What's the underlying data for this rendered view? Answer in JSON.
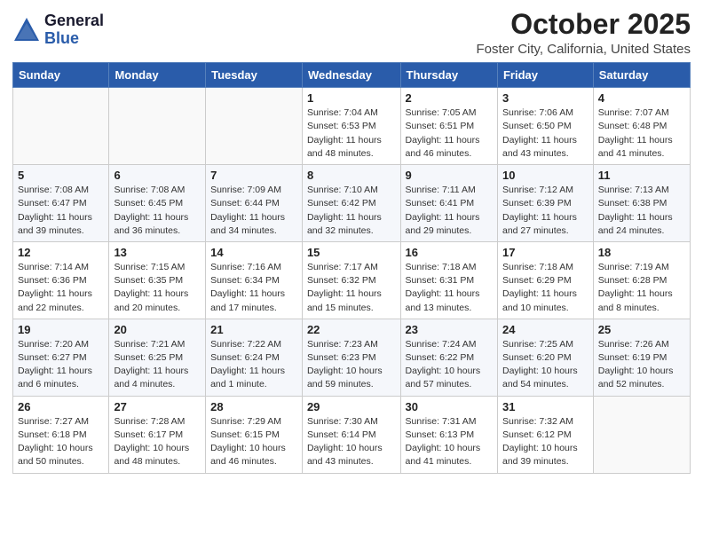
{
  "logo": {
    "general": "General",
    "blue": "Blue"
  },
  "header": {
    "month": "October 2025",
    "location": "Foster City, California, United States"
  },
  "days_of_week": [
    "Sunday",
    "Monday",
    "Tuesday",
    "Wednesday",
    "Thursday",
    "Friday",
    "Saturday"
  ],
  "weeks": [
    [
      {
        "day": "",
        "info": ""
      },
      {
        "day": "",
        "info": ""
      },
      {
        "day": "",
        "info": ""
      },
      {
        "day": "1",
        "info": "Sunrise: 7:04 AM\nSunset: 6:53 PM\nDaylight: 11 hours\nand 48 minutes."
      },
      {
        "day": "2",
        "info": "Sunrise: 7:05 AM\nSunset: 6:51 PM\nDaylight: 11 hours\nand 46 minutes."
      },
      {
        "day": "3",
        "info": "Sunrise: 7:06 AM\nSunset: 6:50 PM\nDaylight: 11 hours\nand 43 minutes."
      },
      {
        "day": "4",
        "info": "Sunrise: 7:07 AM\nSunset: 6:48 PM\nDaylight: 11 hours\nand 41 minutes."
      }
    ],
    [
      {
        "day": "5",
        "info": "Sunrise: 7:08 AM\nSunset: 6:47 PM\nDaylight: 11 hours\nand 39 minutes."
      },
      {
        "day": "6",
        "info": "Sunrise: 7:08 AM\nSunset: 6:45 PM\nDaylight: 11 hours\nand 36 minutes."
      },
      {
        "day": "7",
        "info": "Sunrise: 7:09 AM\nSunset: 6:44 PM\nDaylight: 11 hours\nand 34 minutes."
      },
      {
        "day": "8",
        "info": "Sunrise: 7:10 AM\nSunset: 6:42 PM\nDaylight: 11 hours\nand 32 minutes."
      },
      {
        "day": "9",
        "info": "Sunrise: 7:11 AM\nSunset: 6:41 PM\nDaylight: 11 hours\nand 29 minutes."
      },
      {
        "day": "10",
        "info": "Sunrise: 7:12 AM\nSunset: 6:39 PM\nDaylight: 11 hours\nand 27 minutes."
      },
      {
        "day": "11",
        "info": "Sunrise: 7:13 AM\nSunset: 6:38 PM\nDaylight: 11 hours\nand 24 minutes."
      }
    ],
    [
      {
        "day": "12",
        "info": "Sunrise: 7:14 AM\nSunset: 6:36 PM\nDaylight: 11 hours\nand 22 minutes."
      },
      {
        "day": "13",
        "info": "Sunrise: 7:15 AM\nSunset: 6:35 PM\nDaylight: 11 hours\nand 20 minutes."
      },
      {
        "day": "14",
        "info": "Sunrise: 7:16 AM\nSunset: 6:34 PM\nDaylight: 11 hours\nand 17 minutes."
      },
      {
        "day": "15",
        "info": "Sunrise: 7:17 AM\nSunset: 6:32 PM\nDaylight: 11 hours\nand 15 minutes."
      },
      {
        "day": "16",
        "info": "Sunrise: 7:18 AM\nSunset: 6:31 PM\nDaylight: 11 hours\nand 13 minutes."
      },
      {
        "day": "17",
        "info": "Sunrise: 7:18 AM\nSunset: 6:29 PM\nDaylight: 11 hours\nand 10 minutes."
      },
      {
        "day": "18",
        "info": "Sunrise: 7:19 AM\nSunset: 6:28 PM\nDaylight: 11 hours\nand 8 minutes."
      }
    ],
    [
      {
        "day": "19",
        "info": "Sunrise: 7:20 AM\nSunset: 6:27 PM\nDaylight: 11 hours\nand 6 minutes."
      },
      {
        "day": "20",
        "info": "Sunrise: 7:21 AM\nSunset: 6:25 PM\nDaylight: 11 hours\nand 4 minutes."
      },
      {
        "day": "21",
        "info": "Sunrise: 7:22 AM\nSunset: 6:24 PM\nDaylight: 11 hours\nand 1 minute."
      },
      {
        "day": "22",
        "info": "Sunrise: 7:23 AM\nSunset: 6:23 PM\nDaylight: 10 hours\nand 59 minutes."
      },
      {
        "day": "23",
        "info": "Sunrise: 7:24 AM\nSunset: 6:22 PM\nDaylight: 10 hours\nand 57 minutes."
      },
      {
        "day": "24",
        "info": "Sunrise: 7:25 AM\nSunset: 6:20 PM\nDaylight: 10 hours\nand 54 minutes."
      },
      {
        "day": "25",
        "info": "Sunrise: 7:26 AM\nSunset: 6:19 PM\nDaylight: 10 hours\nand 52 minutes."
      }
    ],
    [
      {
        "day": "26",
        "info": "Sunrise: 7:27 AM\nSunset: 6:18 PM\nDaylight: 10 hours\nand 50 minutes."
      },
      {
        "day": "27",
        "info": "Sunrise: 7:28 AM\nSunset: 6:17 PM\nDaylight: 10 hours\nand 48 minutes."
      },
      {
        "day": "28",
        "info": "Sunrise: 7:29 AM\nSunset: 6:15 PM\nDaylight: 10 hours\nand 46 minutes."
      },
      {
        "day": "29",
        "info": "Sunrise: 7:30 AM\nSunset: 6:14 PM\nDaylight: 10 hours\nand 43 minutes."
      },
      {
        "day": "30",
        "info": "Sunrise: 7:31 AM\nSunset: 6:13 PM\nDaylight: 10 hours\nand 41 minutes."
      },
      {
        "day": "31",
        "info": "Sunrise: 7:32 AM\nSunset: 6:12 PM\nDaylight: 10 hours\nand 39 minutes."
      },
      {
        "day": "",
        "info": ""
      }
    ]
  ]
}
